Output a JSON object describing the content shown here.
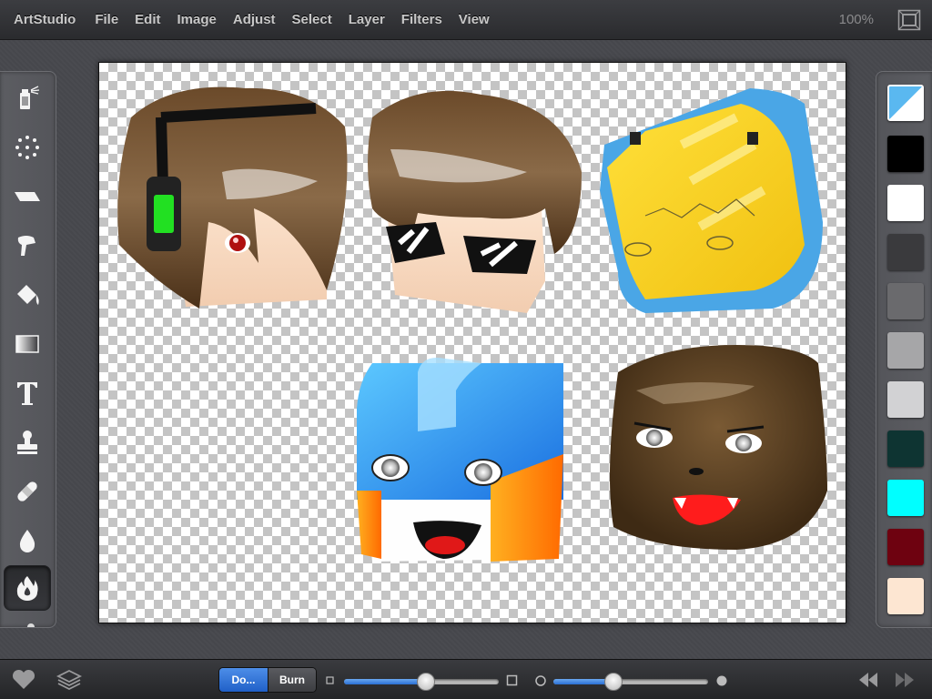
{
  "app": {
    "title": "ArtStudio",
    "menu": [
      "File",
      "Edit",
      "Image",
      "Adjust",
      "Select",
      "Layer",
      "Filters",
      "View"
    ],
    "zoom": "100%"
  },
  "tools": [
    {
      "name": "spray-tool",
      "icon": "spray-can-icon"
    },
    {
      "name": "scatter-tool",
      "icon": "scatter-dots-icon"
    },
    {
      "name": "eraser-tool",
      "icon": "eraser-icon"
    },
    {
      "name": "smudge-tool",
      "icon": "smudge-finger-icon"
    },
    {
      "name": "fill-tool",
      "icon": "paint-bucket-icon"
    },
    {
      "name": "gradient-tool",
      "icon": "gradient-icon"
    },
    {
      "name": "text-tool",
      "icon": "text-icon"
    },
    {
      "name": "clone-stamp-tool",
      "icon": "stamp-icon"
    },
    {
      "name": "heal-tool",
      "icon": "bandage-icon"
    },
    {
      "name": "blur-tool",
      "icon": "water-drop-icon"
    },
    {
      "name": "dodge-burn-tool",
      "icon": "flame-icon",
      "active": true
    }
  ],
  "swatches": [
    "#5ab8f0",
    "#000000",
    "#ffffff",
    "#3a3a3d",
    "#6a6a6d",
    "#a6a6a8",
    "#d2d2d4",
    "#0e3432",
    "#00ffff",
    "#6e0210",
    "#fde6d2"
  ],
  "bottom": {
    "mode_dodge": "Do...",
    "mode_burn": "Burn",
    "active_mode": "dodge",
    "size_level": 0.53,
    "strength_level": 0.39
  },
  "icons": {
    "favorite": "heart-icon",
    "layers": "layers-icon",
    "undo": "undo-icon",
    "redo": "redo-icon",
    "fullscreen": "fullscreen-icon"
  }
}
